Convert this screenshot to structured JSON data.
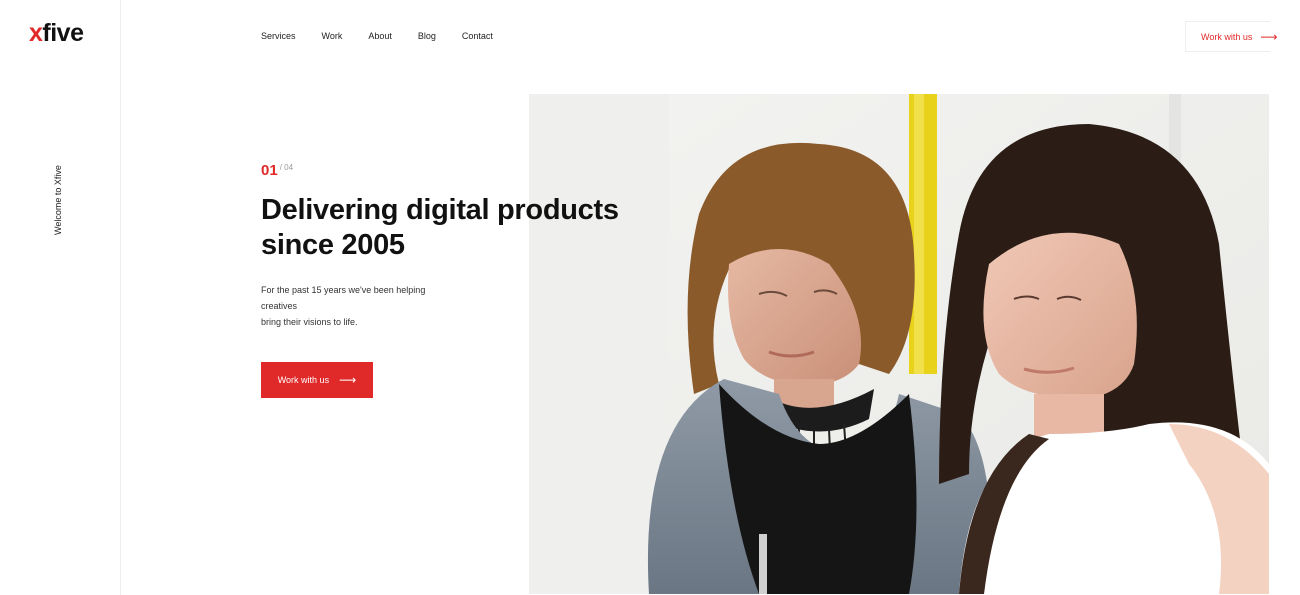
{
  "brand": {
    "logo_x": "x",
    "logo_rest": "five",
    "tagline": "Welcome to Xfive"
  },
  "nav": [
    {
      "label": "Services"
    },
    {
      "label": "Work"
    },
    {
      "label": "About"
    },
    {
      "label": "Blog"
    },
    {
      "label": "Contact"
    }
  ],
  "header_cta": {
    "label": "Work with us",
    "arrow": "⟶"
  },
  "hero": {
    "counter_current": "01",
    "counter_total": "/ 04",
    "headline_line1": "Delivering digital products",
    "headline_line2": "since 2005",
    "description_line1": "For the past 15 years we've been helping creatives",
    "description_line2": "bring their visions to life.",
    "cta_label": "Work with us",
    "cta_arrow": "⟶"
  },
  "colors": {
    "accent": "#e02a2a",
    "text": "#111111"
  }
}
